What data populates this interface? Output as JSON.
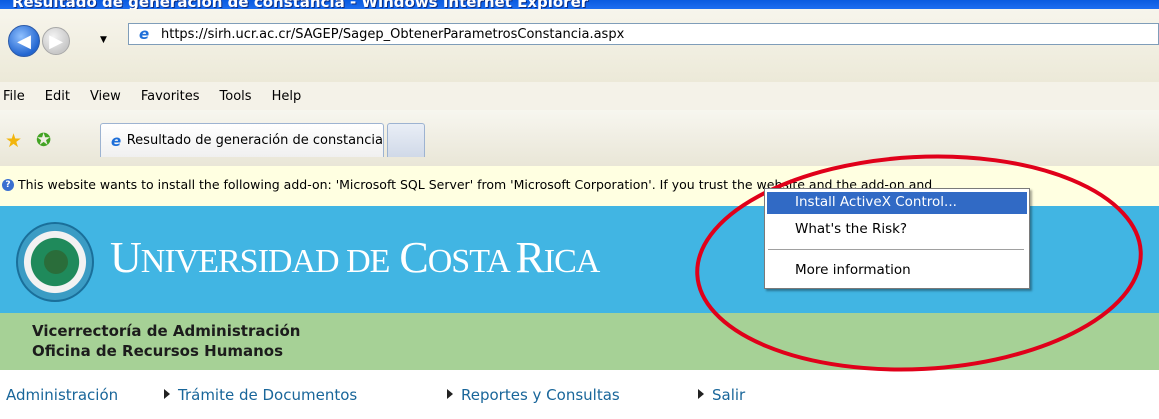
{
  "window": {
    "title": "Resultado de generación de constancia - Windows Internet Explorer"
  },
  "address_bar": {
    "url": "https://sirh.ucr.ac.cr/SAGEP/Sagep_ObtenerParametrosConstancia.aspx"
  },
  "menu": [
    "File",
    "Edit",
    "View",
    "Favorites",
    "Tools",
    "Help"
  ],
  "tabs": {
    "active_label": "Resultado de generación de constancia"
  },
  "infobar": {
    "message": "This website wants to install the following add-on: 'Microsoft SQL Server' from 'Microsoft Corporation'. If you trust the website and the add-on and"
  },
  "context_menu": {
    "install": "Install ActiveX Control...",
    "risk": "What's the Risk?",
    "more": "More information"
  },
  "banner": {
    "title_U": "U",
    "title_niversidad": "NIVERSIDAD ",
    "title_de": "DE",
    "title_C": " C",
    "title_osta": "OSTA ",
    "title_R": "R",
    "title_ica": "ICA",
    "vice": "Vicerrectoría de Administración",
    "oficina": "Oficina de Recursos Humanos"
  },
  "nav": {
    "admin": "Administración",
    "tramite": "Trámite de Documentos",
    "reportes": "Reportes y Consultas",
    "salir": "Salir"
  },
  "colors": {
    "banner_blue": "#41b5e3",
    "sub_green": "#a6d196",
    "link": "#19669a",
    "annotation_red": "#e0001a",
    "menu_highlight": "#316ac5"
  },
  "icons": [
    "back-arrow-icon",
    "forward-arrow-icon",
    "ie-page-icon",
    "favorites-star-icon",
    "add-favorites-icon",
    "info-icon",
    "ucr-seal-logo"
  ]
}
